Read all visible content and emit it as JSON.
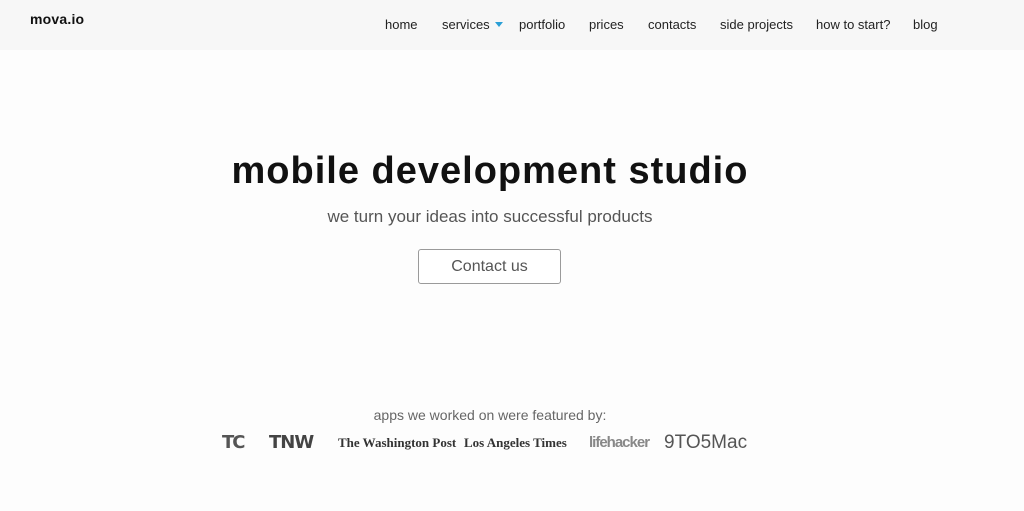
{
  "header": {
    "logo": "mova.io",
    "nav": [
      {
        "label": "home"
      },
      {
        "label": "services"
      },
      {
        "label": "portfolio"
      },
      {
        "label": "prices"
      },
      {
        "label": "contacts"
      },
      {
        "label": "side projects"
      },
      {
        "label": "how to start?"
      },
      {
        "label": "blog"
      }
    ]
  },
  "hero": {
    "title": "mobile development studio",
    "subtitle": "we turn your ideas into successful products",
    "cta_label": "Contact us"
  },
  "featured": {
    "label": "apps we worked on were featured by:",
    "logos": [
      {
        "text": "TC",
        "icon": "techcrunch-logo"
      },
      {
        "text": "TNW",
        "icon": "tnw-logo"
      },
      {
        "text": "The Washington Post",
        "icon": "washington-post-logo"
      },
      {
        "text": "Los Angeles Times",
        "icon": "los-angeles-times-logo"
      },
      {
        "text": "lifehacker",
        "icon": "lifehacker-logo"
      },
      {
        "text": "9TO5Mac",
        "icon": "9to5mac-logo"
      }
    ]
  },
  "colors": {
    "accent": "#2a9fd6",
    "header_bg": "#f7f7f7"
  }
}
